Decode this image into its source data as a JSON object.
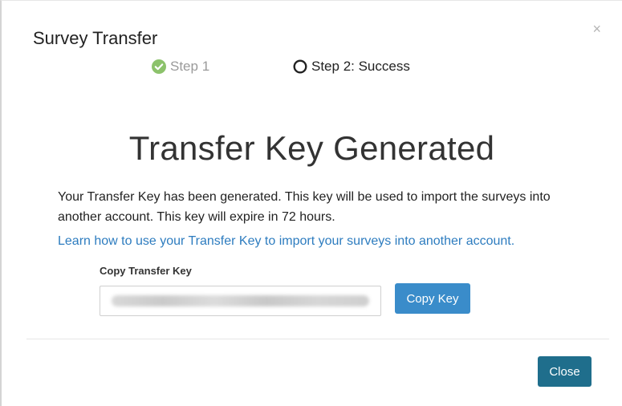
{
  "dialog": {
    "title": "Survey Transfer",
    "close_glyph": "×"
  },
  "steps": [
    {
      "label": "Step 1",
      "state": "complete",
      "icon": "check-circle-icon"
    },
    {
      "label": "Step 2: Success",
      "state": "current",
      "icon": "circle-outline-icon"
    }
  ],
  "main": {
    "heading": "Transfer Key Generated",
    "description": "Your Transfer Key has been generated. This key will be used to import the surveys into another account. This key will expire in 72 hours.",
    "learn_link": "Learn how to use your Transfer Key to import your surveys into another account.",
    "copy_label": "Copy Transfer Key",
    "copy_button": "Copy Key"
  },
  "footer": {
    "close_button": "Close"
  },
  "colors": {
    "step_complete": "#8cc26b",
    "link": "#2d7cbf",
    "copy_button": "#3a8cca",
    "close_button": "#1f6e8c"
  }
}
